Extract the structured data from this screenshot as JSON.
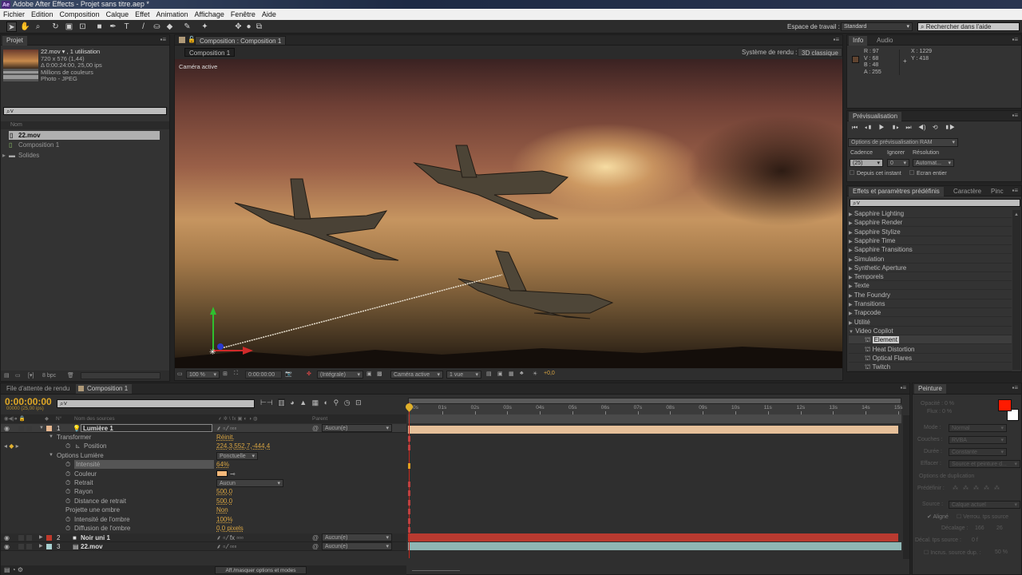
{
  "app_title": "Adobe After Effects - Projet sans titre.aep *",
  "app_badge": "Ae",
  "menu": [
    "Fichier",
    "Edition",
    "Composition",
    "Calque",
    "Effet",
    "Animation",
    "Affichage",
    "Fenêtre",
    "Aide"
  ],
  "workspace": {
    "label": "Espace de travail :",
    "value": "Standard",
    "help_placeholder": "Rechercher dans l'aide"
  },
  "project": {
    "tab": "Projet",
    "item_name": "22.mov ▾ , 1 utilisation",
    "item_info": [
      "720 x 576 (1,44)",
      "Δ 0:00:24:00, 25,00 ips",
      "Millions de couleurs",
      "Photo - JPEG"
    ],
    "search_placeholder": "⌕˅",
    "column": "Nom",
    "items": [
      {
        "name": "22.mov",
        "icon": "footage-icon"
      },
      {
        "name": "Composition 1",
        "icon": "composition-icon"
      },
      {
        "name": "Solides",
        "icon": "folder-icon"
      }
    ],
    "bpc": "8 bpc"
  },
  "composition": {
    "tab": "Composition : Composition 1",
    "subtab": "Composition 1",
    "renderer_label": "Système de rendu :",
    "renderer": "3D classique",
    "camera_label": "Caméra active",
    "zoom": "100 %",
    "timecode": "0:00:00:00",
    "resolution": "(Intégrale)",
    "view": "Caméra active",
    "layout": "1 vue",
    "exposure": "+0,0"
  },
  "info": {
    "tabs": [
      "Info",
      "Audio"
    ],
    "R": "R : 97",
    "V": "V : 68",
    "B": "B : 48",
    "A": "A : 255",
    "X": "X : 1229",
    "Y": "Y : 418",
    "swatch": "#614430"
  },
  "preview": {
    "tab": "Prévisualisation",
    "ram_options": "Options de prévisualisation RAM",
    "cadence_label": "Cadence",
    "ignore_label": "Ignorer",
    "resolution_label": "Résolution",
    "cadence": "(25)",
    "ignore": "0",
    "resolution": "Automat...",
    "from_now": "Depuis cet instant",
    "fullscreen": "Ecran entier"
  },
  "effects": {
    "tabs": [
      "Effets et paramètres prédéfinis",
      "Caractère",
      "Pinc"
    ],
    "search_placeholder": "⌕˅",
    "categories": [
      "Sapphire Lighting",
      "Sapphire Render",
      "Sapphire Stylize",
      "Sapphire Time",
      "Sapphire Transitions",
      "Simulation",
      "Synthetic Aperture",
      "Temporels",
      "Texte",
      "The Foundry",
      "Transitions",
      "Trapcode",
      "Utilité",
      "Video Copilot"
    ],
    "video_copilot_items": [
      "Element",
      "Heat Distortion",
      "Optical Flares",
      "Twitch"
    ]
  },
  "timeline": {
    "tabs": [
      "File d'attente de rendu",
      "Composition 1"
    ],
    "timecode": "0:00:00:00",
    "frames": "00000 (25,00 ips)",
    "search_placeholder": "⌕˅",
    "col_num": "N°",
    "col_name": "Nom des sources",
    "col_switches": "⸙ ✲ \\ fx ▣ ◐ ◑ ◍",
    "col_parent": "Parent",
    "ruler": [
      "0s",
      "01s",
      "02s",
      "03s",
      "04s",
      "05s",
      "06s",
      "07s",
      "08s",
      "09s",
      "10s",
      "11s",
      "12s",
      "13s",
      "14s",
      "15s"
    ],
    "layers": [
      {
        "num": "1",
        "name": "Lumière 1",
        "color": "#e8b890",
        "parent": "Aucun(e)"
      },
      {
        "num": "2",
        "name": "Noir uni 1",
        "color": "#c0392b",
        "parent": "Aucun(e)"
      },
      {
        "num": "3",
        "name": "22.mov",
        "color": "#a8d0d0",
        "parent": "Aucun(e)"
      }
    ],
    "props": [
      {
        "name": "Transformer",
        "value": "Réinit.",
        "level": 0
      },
      {
        "name": "Position",
        "value": "224,3,552,7,-444,4",
        "level": 2
      },
      {
        "name": "Options Lumière",
        "value": "Ponctuelle",
        "level": 0
      },
      {
        "name": "Intensité",
        "value": "64%",
        "level": 1
      },
      {
        "name": "Couleur",
        "value": "",
        "level": 1
      },
      {
        "name": "Retrait",
        "value": "Aucun",
        "level": 1
      },
      {
        "name": "Rayon",
        "value": "500,0",
        "level": 1
      },
      {
        "name": "Distance de retrait",
        "value": "500,0",
        "level": 1
      },
      {
        "name": "Projette une ombre",
        "value": "Non",
        "level": 3
      },
      {
        "name": "Intensité de l'ombre",
        "value": "100%",
        "level": 1
      },
      {
        "name": "Diffusion de l'ombre",
        "value": "0,0 pixels",
        "level": 1
      }
    ],
    "light_color": "#f5b97a",
    "toggle_label": "Aff./masquer options et modes"
  },
  "paint": {
    "tab": "Peinture",
    "opacity": "Opacité : 0 %",
    "flow": "Flux : 0 %",
    "mode_label": "Mode :",
    "mode": "Normal",
    "channels_label": "Couches :",
    "channels": "RVBA",
    "duration_label": "Durée :",
    "duration": "Constante",
    "erase_label": "Effacer :",
    "erase": "Source et peinture d...",
    "clone_options": "Options de duplication",
    "preset_label": "Prédéfinir :",
    "source_label": "Source :",
    "source": "Calque actuel",
    "aligned": "Aligné",
    "lock_source": "Verrou. tps source",
    "offset_label": "Décalage :",
    "offset_x": "166",
    "offset_y": "26",
    "source_time_label": "Décal. tps source :",
    "source_time": "0 f",
    "overlay_label": "Incrus. source dup. :",
    "overlay": "50 %",
    "fg": "#ff1a00",
    "bg": "#ffffff"
  }
}
